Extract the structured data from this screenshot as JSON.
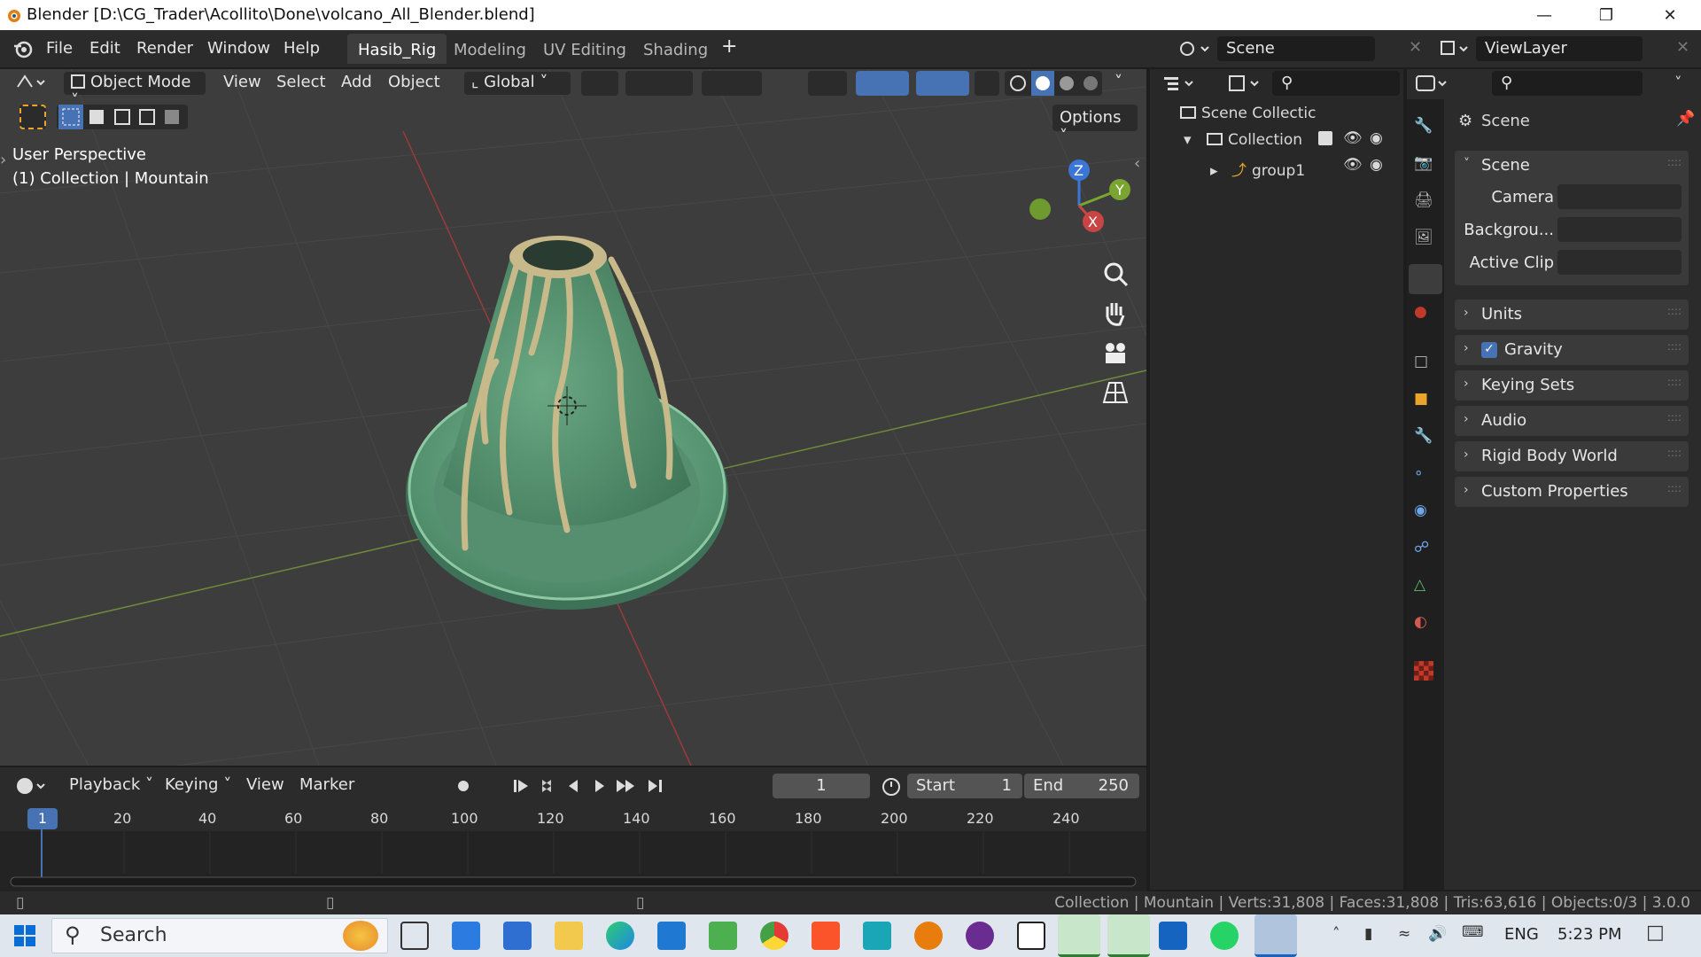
{
  "titlebar": {
    "title": "Blender [D:\\CG_Trader\\Acollito\\Done\\volcano_All_Blender.blend]"
  },
  "menu": [
    "File",
    "Edit",
    "Render",
    "Window",
    "Help"
  ],
  "workspaces": [
    "Hasib_Rig",
    "Modeling",
    "UV Editing",
    "Shading"
  ],
  "scene_field": "Scene",
  "viewlayer_field": "ViewLayer",
  "viewport": {
    "mode": "Object Mode",
    "menus": [
      "View",
      "Select",
      "Add",
      "Object"
    ],
    "transform": "Global",
    "options": "Options",
    "overlay_line1": "User Perspective",
    "overlay_line2": "(1) Collection | Mountain",
    "gizmo": {
      "z": "Z",
      "y": "Y",
      "x": "X"
    }
  },
  "timeline": {
    "menus": [
      "Playback",
      "Keying",
      "View",
      "Marker"
    ],
    "current_frame": "1",
    "start_label": "Start",
    "start": "1",
    "end_label": "End",
    "end": "250",
    "ruler": [
      "1",
      "20",
      "40",
      "60",
      "80",
      "100",
      "120",
      "140",
      "160",
      "180",
      "200",
      "220",
      "240"
    ]
  },
  "outliner": {
    "rows": [
      {
        "label": "Scene Collectic"
      },
      {
        "label": "Collection"
      },
      {
        "label": "group1"
      }
    ]
  },
  "properties": {
    "header": "Scene",
    "section": "Scene",
    "fields": [
      {
        "label": "Camera"
      },
      {
        "label": "Backgrou..."
      },
      {
        "label": "Active Clip"
      }
    ],
    "panels": [
      "Units",
      "Gravity",
      "Keying Sets",
      "Audio",
      "Rigid Body World",
      "Custom Properties"
    ]
  },
  "statusbar": {
    "text": "Collection | Mountain | Verts:31,808 | Faces:31,808 | Tris:63,616 | Objects:0/3 | 3.0.0"
  },
  "taskbar": {
    "search": "Search",
    "lang": "ENG",
    "time": "5:23 PM"
  },
  "colors": {
    "accent": "#4772b3",
    "mesh": "#5f9b78",
    "lava": "#c7b98a"
  }
}
